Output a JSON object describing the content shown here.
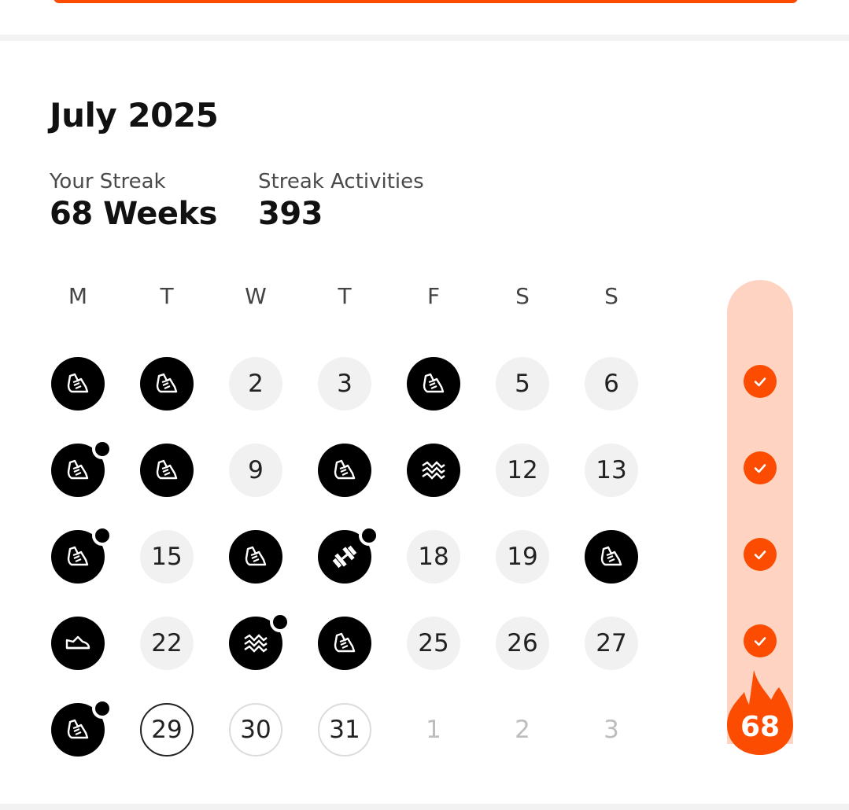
{
  "header": {
    "month_title": "July 2025"
  },
  "stats": {
    "streak_label": "Your Streak",
    "streak_value": "68 Weeks",
    "activities_label": "Streak Activities",
    "activities_value": "393"
  },
  "weekdays": [
    "M",
    "T",
    "W",
    "T",
    "F",
    "S",
    "S"
  ],
  "weeks": [
    [
      {
        "type": "activity",
        "icon": "run-shoe-icon"
      },
      {
        "type": "activity",
        "icon": "run-shoe-icon"
      },
      {
        "type": "plain",
        "label": "2"
      },
      {
        "type": "plain",
        "label": "3"
      },
      {
        "type": "activity",
        "icon": "run-shoe-icon"
      },
      {
        "type": "plain",
        "label": "5"
      },
      {
        "type": "plain",
        "label": "6"
      }
    ],
    [
      {
        "type": "activity",
        "icon": "run-shoe-icon",
        "multi": true
      },
      {
        "type": "activity",
        "icon": "run-shoe-icon"
      },
      {
        "type": "plain",
        "label": "9"
      },
      {
        "type": "activity",
        "icon": "run-shoe-icon"
      },
      {
        "type": "activity",
        "icon": "hiit-wave-icon"
      },
      {
        "type": "plain",
        "label": "12"
      },
      {
        "type": "plain",
        "label": "13"
      }
    ],
    [
      {
        "type": "activity",
        "icon": "run-shoe-icon",
        "multi": true
      },
      {
        "type": "plain",
        "label": "15"
      },
      {
        "type": "activity",
        "icon": "run-shoe-icon"
      },
      {
        "type": "activity",
        "icon": "dumbbell-icon",
        "multi": true
      },
      {
        "type": "plain",
        "label": "18"
      },
      {
        "type": "plain",
        "label": "19"
      },
      {
        "type": "activity",
        "icon": "run-shoe-icon"
      }
    ],
    [
      {
        "type": "activity",
        "icon": "sneaker-icon"
      },
      {
        "type": "plain",
        "label": "22"
      },
      {
        "type": "activity",
        "icon": "hiit-wave-icon",
        "multi": true
      },
      {
        "type": "activity",
        "icon": "run-shoe-icon"
      },
      {
        "type": "plain",
        "label": "25"
      },
      {
        "type": "plain",
        "label": "26"
      },
      {
        "type": "plain",
        "label": "27"
      }
    ],
    [
      {
        "type": "activity",
        "icon": "run-shoe-icon",
        "multi": true
      },
      {
        "type": "today",
        "label": "29"
      },
      {
        "type": "future",
        "label": "30"
      },
      {
        "type": "future",
        "label": "31"
      },
      {
        "type": "next",
        "label": "1"
      },
      {
        "type": "next",
        "label": "2"
      },
      {
        "type": "next",
        "label": "3"
      }
    ]
  ],
  "week_status": [
    "check-icon",
    "check-icon",
    "check-icon",
    "check-icon"
  ],
  "streak_badge": {
    "icon": "flame-icon",
    "value": "68"
  },
  "colors": {
    "accent": "#fc4c02",
    "streak_pill": "#fed3c1",
    "day_bg": "#f1f1f1",
    "activity_bg": "#000000"
  }
}
